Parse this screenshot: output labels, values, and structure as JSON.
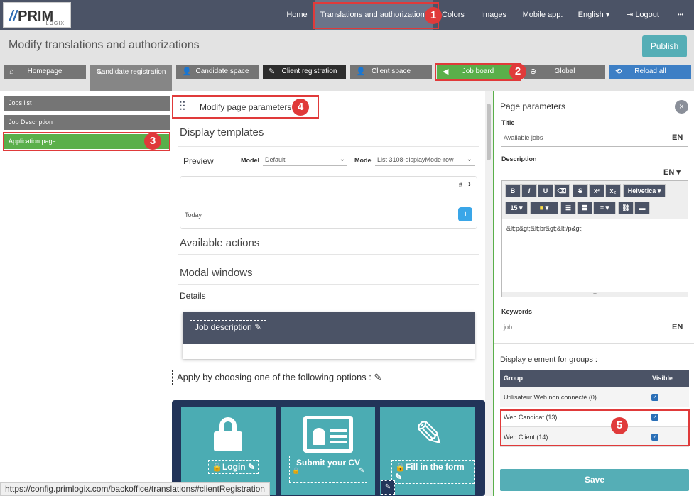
{
  "brand": {
    "logo_text": "PRIM",
    "logo_sub": "LOGIX"
  },
  "nav": {
    "items": [
      "Home",
      "Translations and authorizations",
      "Colors",
      "Images",
      "Mobile app."
    ],
    "language": "English",
    "logout": "Logout",
    "more": "•••"
  },
  "header": {
    "title": "Modify translations and authorizations",
    "publish": "Publish"
  },
  "tabs": [
    "Homepage",
    "Candidate registration",
    "Candidate space",
    "Client registration",
    "Client space",
    "Job board",
    "Global",
    "Reload all"
  ],
  "left": {
    "items": [
      "Jobs list",
      "Job Description",
      "Application page"
    ]
  },
  "middle": {
    "modify_params": "Modify page parameters",
    "display_templates": "Display templates",
    "preview": "Preview",
    "model_label": "Model",
    "model_value": "Default",
    "mode_label": "Mode",
    "mode_value": "List 3108-displayMode-row",
    "card_hash": "#",
    "card_today": "Today",
    "available_actions": "Available actions",
    "modal_windows": "Modal windows",
    "details": "Details",
    "job_description": "Job description",
    "apply_text": "Apply by choosing one of the following options :",
    "tiles": [
      "Login",
      "Submit your CV",
      "Fill in the form"
    ]
  },
  "right": {
    "heading": "Page parameters",
    "title_label": "Title",
    "title_value": "Available jobs",
    "lang": "EN",
    "description_label": "Description",
    "editor": {
      "font": "Helvetica",
      "size": "15",
      "content": "&lt;p&gt;&lt;br&gt;&lt;/p&gt;",
      "buttons": [
        "B",
        "I",
        "U",
        "S",
        "x²",
        "x₂"
      ]
    },
    "keywords_label": "Keywords",
    "keywords_value": "job",
    "groups_label": "Display element for groups :",
    "groups_header": [
      "Group",
      "Visible"
    ],
    "groups": [
      "Utilisateur Web non connecté (0)",
      "Web Candidat (13)",
      "Web Client (14)"
    ],
    "save": "Save"
  },
  "callouts": [
    "1",
    "2",
    "3",
    "4",
    "5"
  ],
  "status": "https://config.primlogix.com/backoffice/translations#clientRegistration"
}
